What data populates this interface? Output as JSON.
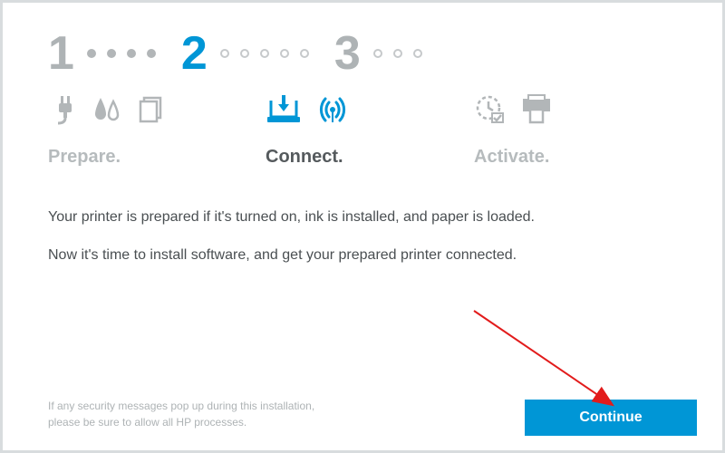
{
  "steps": {
    "s1": {
      "num": "1",
      "label": "Prepare."
    },
    "s2": {
      "num": "2",
      "label": "Connect."
    },
    "s3": {
      "num": "3",
      "label": "Activate."
    }
  },
  "info": {
    "line1": "Your printer is prepared if it's turned on, ink is installed, and paper is loaded.",
    "line2": "Now it's time to install software, and get your prepared printer connected."
  },
  "footnote": {
    "line1": "If any security messages pop up during this installation,",
    "line2": "please be sure to allow all HP processes."
  },
  "buttons": {
    "continue": "Continue"
  },
  "colors": {
    "accent": "#0096d6",
    "muted": "#aeb3b5"
  }
}
